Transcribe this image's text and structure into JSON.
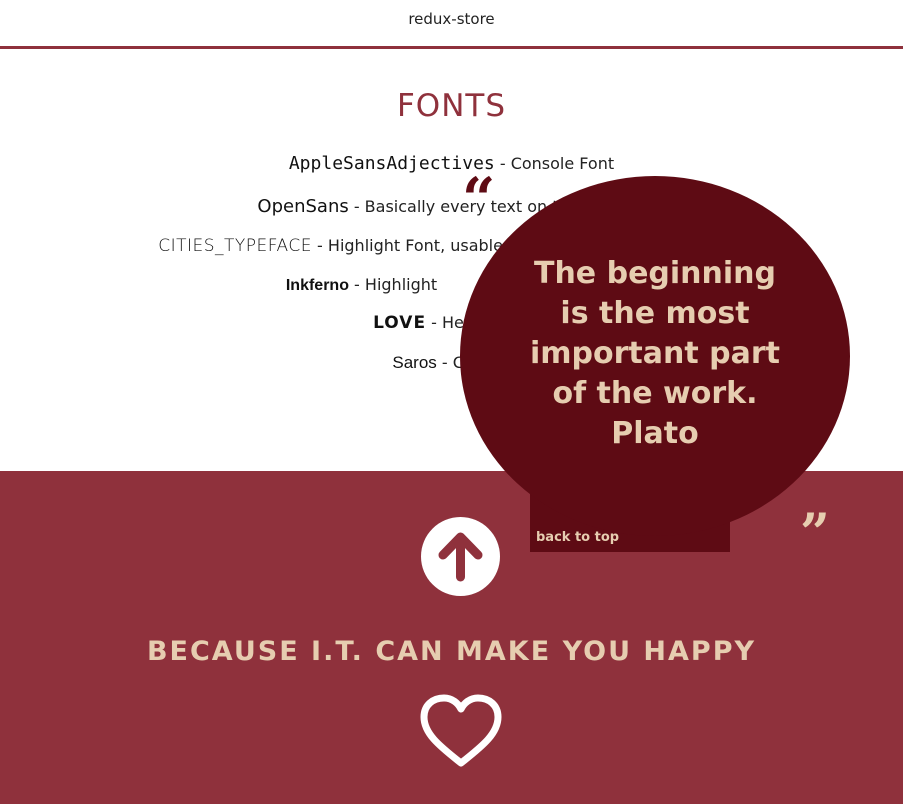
{
  "header": {
    "title": "redux-store"
  },
  "fonts_section": {
    "heading": "FONTS",
    "rows": [
      {
        "name": "AppleSansAdjectives",
        "desc": " - Console Font"
      },
      {
        "name": "OpenSans",
        "desc": " - Basically every text on the website"
      },
      {
        "name": "CITIES_TYPEFACE",
        "desc": " - Highlight Font, usable for titles"
      },
      {
        "name": "Inkferno",
        "desc": " - Highlight"
      },
      {
        "name": "LOVE",
        "desc": " - He"
      },
      {
        "name": "Saros",
        "desc": " - Clear"
      }
    ]
  },
  "quote_bubble": {
    "open_mark": "“",
    "close_mark": "”",
    "lines": [
      "The beginning",
      "is the most",
      "important part",
      "of the work.",
      "Plato"
    ],
    "back_to_top": "back to top"
  },
  "footer": {
    "tagline": "BECAUSE I.T. CAN MAKE YOU HAPPY",
    "up_icon": "arrow-up-icon",
    "heart_icon": "heart-icon"
  },
  "colors": {
    "accent": "#8f313c",
    "bubble": "#5e0b14",
    "cream": "#e6cdb0"
  }
}
